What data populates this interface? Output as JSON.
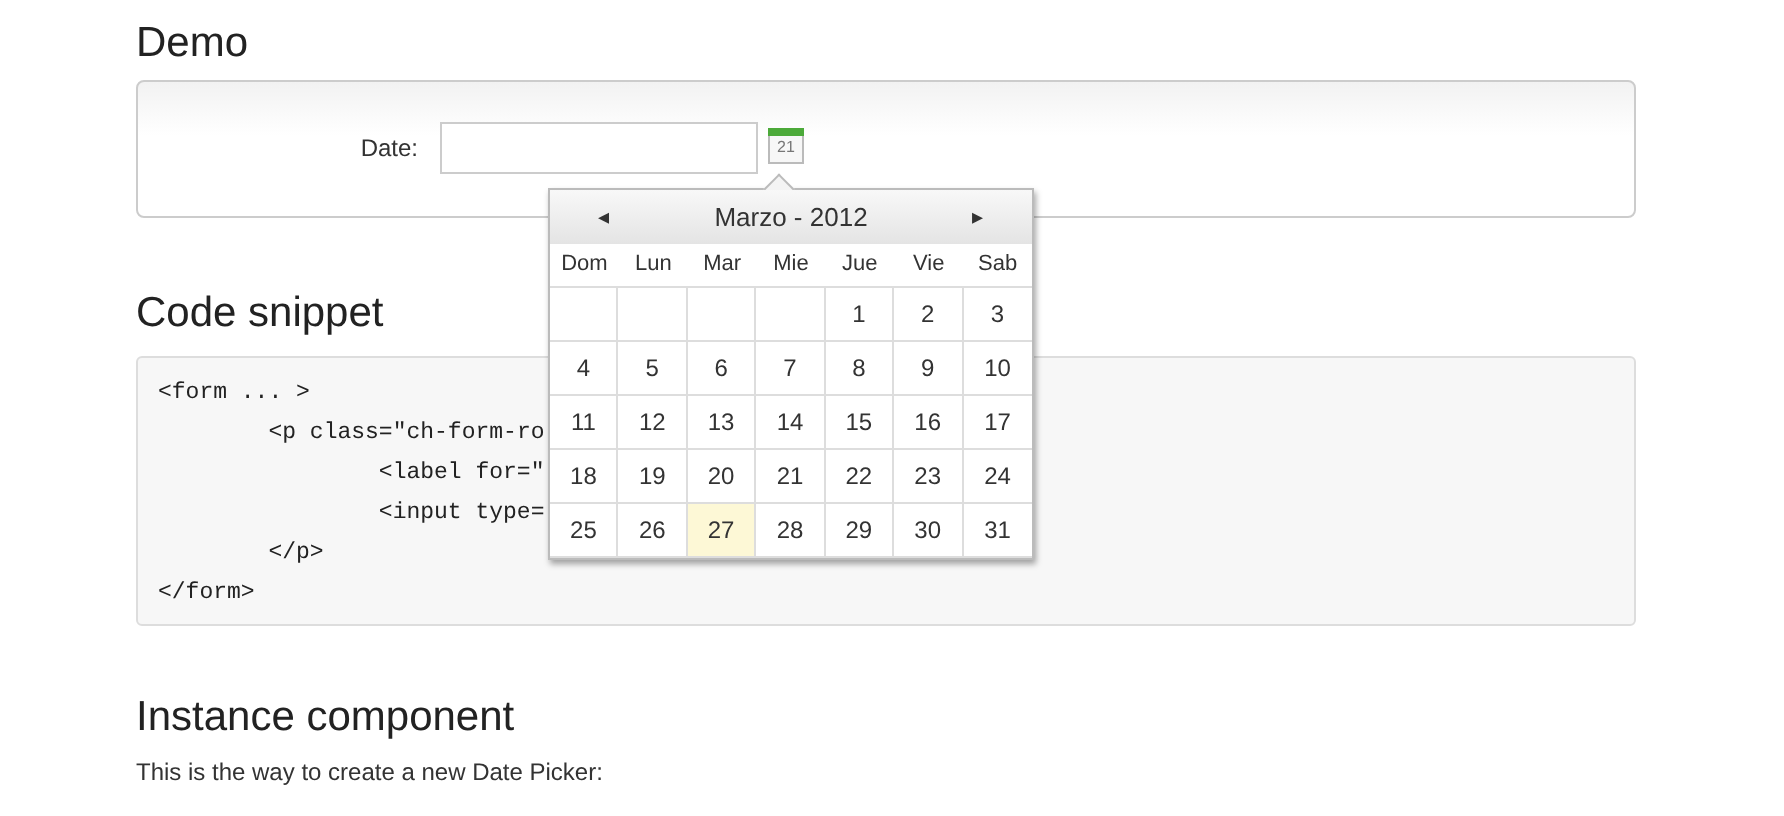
{
  "demo": {
    "title": "Demo",
    "date_label": "Date:",
    "calendar_icon_day": "21",
    "datepicker": {
      "month_title": "Marzo - 2012",
      "prev": "◂",
      "next": "▸",
      "weekdays": [
        "Dom",
        "Lun",
        "Mar",
        "Mie",
        "Jue",
        "Vie",
        "Sab"
      ],
      "weeks": [
        [
          {
            "kind": "blank",
            "selected": false
          },
          {
            "kind": "blank",
            "selected": false
          },
          {
            "kind": "blank",
            "selected": false
          },
          {
            "kind": "blank",
            "selected": false
          },
          {
            "kind": "day",
            "day": "1",
            "selected": false
          },
          {
            "kind": "day",
            "day": "2",
            "selected": false
          },
          {
            "kind": "day",
            "day": "3",
            "selected": false
          }
        ],
        [
          {
            "kind": "day",
            "day": "4",
            "selected": false
          },
          {
            "kind": "day",
            "day": "5",
            "selected": false
          },
          {
            "kind": "day",
            "day": "6",
            "selected": false
          },
          {
            "kind": "day",
            "day": "7",
            "selected": false
          },
          {
            "kind": "day",
            "day": "8",
            "selected": false
          },
          {
            "kind": "day",
            "day": "9",
            "selected": false
          },
          {
            "kind": "day",
            "day": "10",
            "selected": false
          }
        ],
        [
          {
            "kind": "day",
            "day": "11",
            "selected": false
          },
          {
            "kind": "day",
            "day": "12",
            "selected": false
          },
          {
            "kind": "day",
            "day": "13",
            "selected": false
          },
          {
            "kind": "day",
            "day": "14",
            "selected": false
          },
          {
            "kind": "day",
            "day": "15",
            "selected": false
          },
          {
            "kind": "day",
            "day": "16",
            "selected": false
          },
          {
            "kind": "day",
            "day": "17",
            "selected": false
          }
        ],
        [
          {
            "kind": "day",
            "day": "18",
            "selected": false
          },
          {
            "kind": "day",
            "day": "19",
            "selected": false
          },
          {
            "kind": "day",
            "day": "20",
            "selected": false
          },
          {
            "kind": "day",
            "day": "21",
            "selected": false
          },
          {
            "kind": "day",
            "day": "22",
            "selected": false
          },
          {
            "kind": "day",
            "day": "23",
            "selected": false
          },
          {
            "kind": "day",
            "day": "24",
            "selected": false
          }
        ],
        [
          {
            "kind": "day",
            "day": "25",
            "selected": false
          },
          {
            "kind": "day",
            "day": "26",
            "selected": false
          },
          {
            "kind": "day",
            "day": "27",
            "selected": true
          },
          {
            "kind": "day",
            "day": "28",
            "selected": false
          },
          {
            "kind": "day",
            "day": "29",
            "selected": false
          },
          {
            "kind": "day",
            "day": "30",
            "selected": false
          },
          {
            "kind": "day",
            "day": "31",
            "selected": false
          }
        ]
      ]
    }
  },
  "code_snippet": {
    "title": "Code snippet",
    "lines": [
      "<form ... >",
      "\t<p class=\"ch-form-ro",
      "\t\t<label for=\"",
      "\t\t<input type=",
      "\t</p>",
      "</form>"
    ]
  },
  "instance": {
    "title": "Instance component",
    "text": "This is the way to create a new Date Picker:"
  }
}
